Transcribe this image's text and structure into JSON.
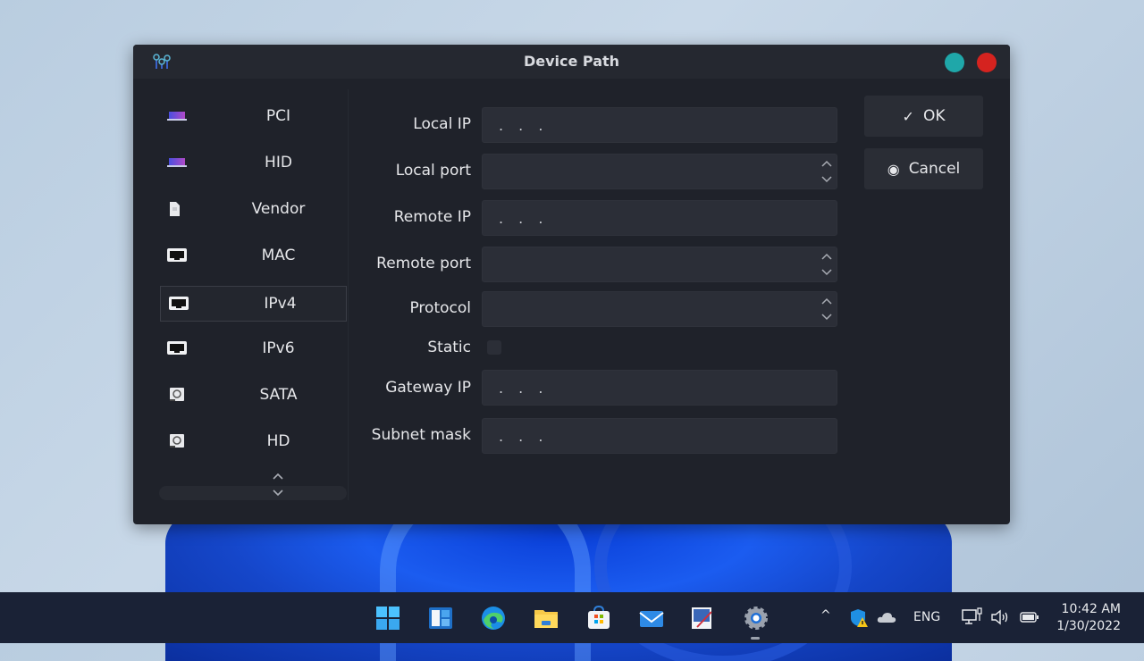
{
  "window": {
    "title": "Device Path",
    "app_icon": "network-nodes-icon",
    "controls": [
      {
        "name": "minimize",
        "color": "#1fa7a9"
      },
      {
        "name": "close",
        "color": "#d5231f"
      }
    ]
  },
  "sidebar": {
    "items": [
      {
        "label": "PCI",
        "icon": "laptop-icon",
        "selected": false
      },
      {
        "label": "HID",
        "icon": "laptop-icon",
        "selected": false
      },
      {
        "label": "Vendor",
        "icon": "document-icon",
        "selected": false
      },
      {
        "label": "MAC",
        "icon": "ethernet-port-icon",
        "selected": false
      },
      {
        "label": "IPv4",
        "icon": "ethernet-port-icon",
        "selected": true
      },
      {
        "label": "IPv6",
        "icon": "ethernet-port-icon",
        "selected": false
      },
      {
        "label": "SATA",
        "icon": "hard-drive-icon",
        "selected": false
      },
      {
        "label": "HD",
        "icon": "hard-drive-icon",
        "selected": false
      }
    ],
    "scroll_up": "⌃",
    "scroll_down": "⌄"
  },
  "form": {
    "local_ip": {
      "label": "Local IP",
      "value": ". . ."
    },
    "local_port": {
      "label": "Local port",
      "value": ""
    },
    "remote_ip": {
      "label": "Remote IP",
      "value": ". . ."
    },
    "remote_port": {
      "label": "Remote port",
      "value": ""
    },
    "protocol": {
      "label": "Protocol",
      "value": ""
    },
    "static": {
      "label": "Static",
      "checked": false
    },
    "gateway_ip": {
      "label": "Gateway IP",
      "value": ". . ."
    },
    "subnet_mask": {
      "label": "Subnet mask",
      "value": ". . ."
    },
    "spin_up": "⌃",
    "spin_down": "⌄"
  },
  "buttons": {
    "ok": {
      "label": "OK",
      "icon": "✓"
    },
    "cancel": {
      "label": "Cancel",
      "icon": "◉"
    }
  },
  "taskbar": {
    "apps": [
      "start",
      "widgets",
      "edge",
      "file-explorer",
      "store",
      "mail",
      "paint",
      "settings"
    ],
    "tray": {
      "chevron": "^",
      "language": "ENG",
      "time": "10:42 AM",
      "date": "1/30/2022"
    }
  }
}
